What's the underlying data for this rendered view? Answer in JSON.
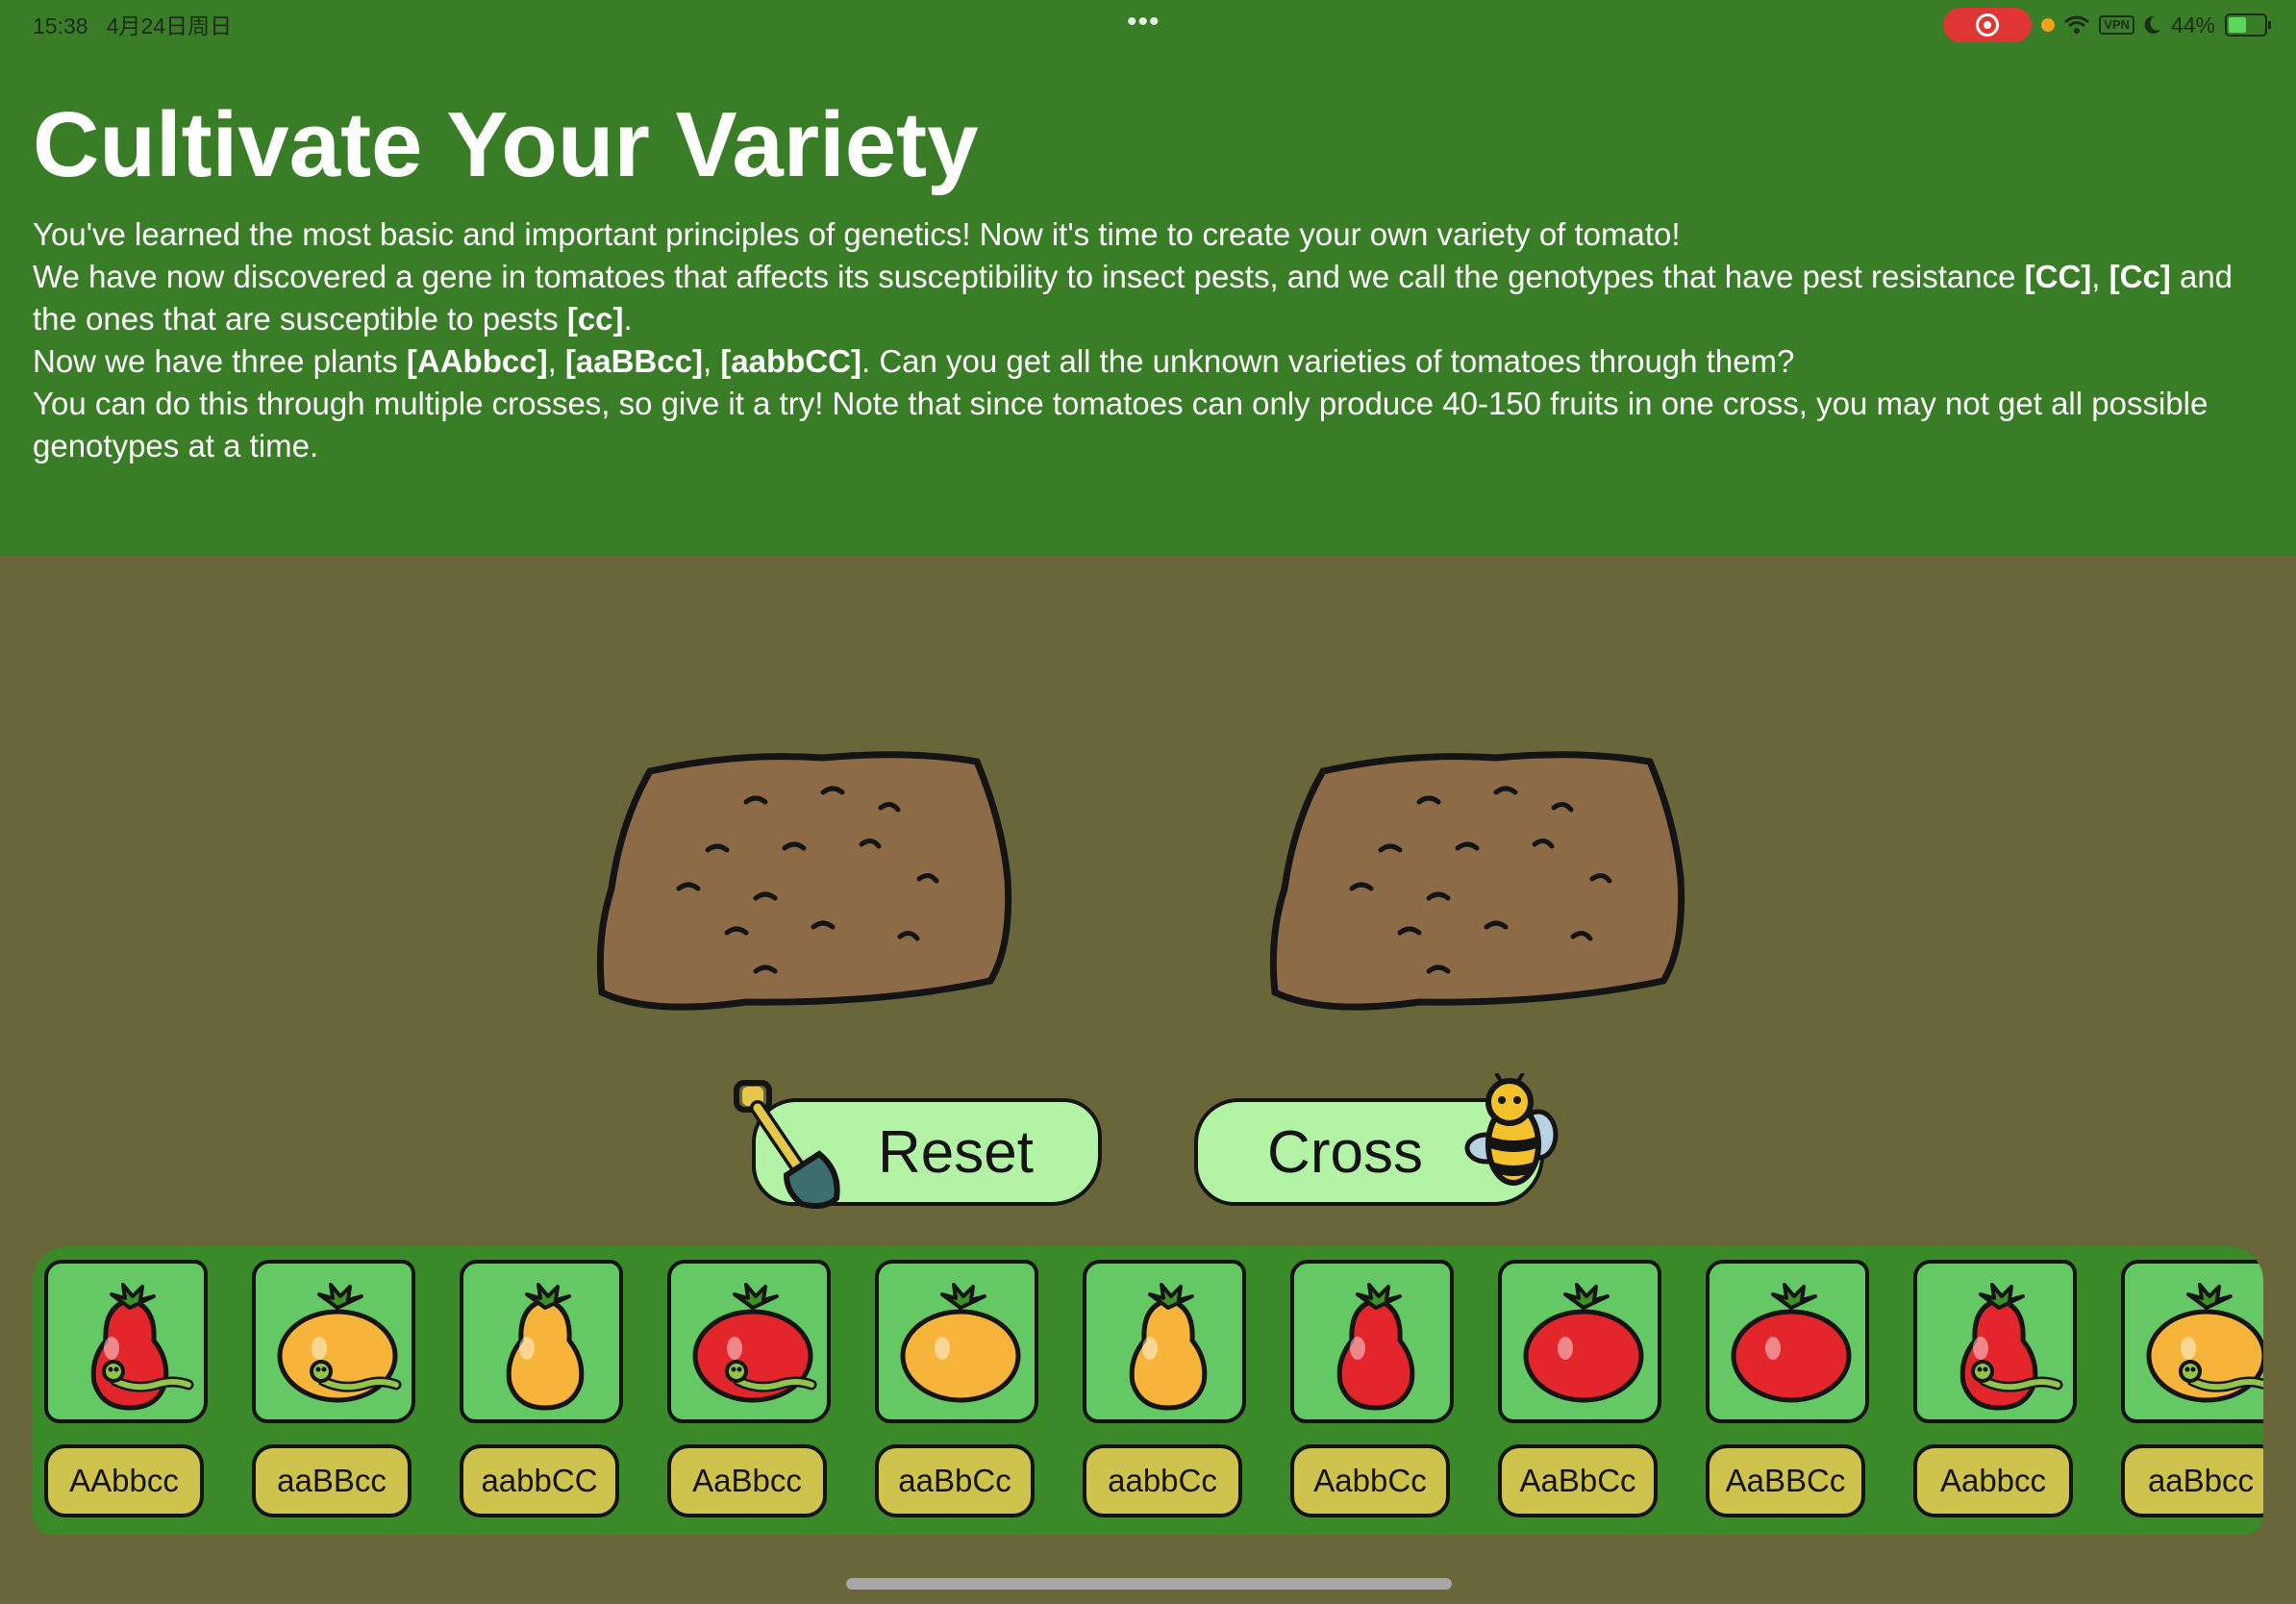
{
  "status_bar": {
    "time": "15:38",
    "date": "4月24日周日",
    "more_dots": "•••",
    "vpn": "VPN",
    "battery": "44%"
  },
  "header": {
    "title": "Cultivate Your Variety",
    "para1": "You've learned the most basic and important principles of genetics! Now it's time to create your own variety of tomato!",
    "para2": {
      "text_a": "We have now discovered a gene in tomatoes that affects its susceptibility to insect pests, and we call the genotypes that have pest resistance ",
      "b1": "[CC]",
      "text_b": ", ",
      "b2": "[Cc]",
      "text_c": " and the ones that are susceptible to pests ",
      "b3": "[cc]",
      "text_d": "."
    },
    "para3": {
      "text_a": "Now we have three plants ",
      "b1": "[AAbbcc]",
      "text_b": ", ",
      "b2": "[aaBBcc]",
      "text_c": ", ",
      "b3": "[aabbCC]",
      "text_d": ". Can you get all the unknown varieties of tomatoes through them?"
    },
    "para4": "You can do this through multiple crosses, so give it a try! Note that since tomatoes can only produce 40-150 fruits in one cross, you may not get all possible genotypes at a time."
  },
  "buttons": {
    "reset": "Reset",
    "cross": "Cross"
  },
  "varieties": [
    {
      "label": "AAbbcc",
      "color": "red",
      "shape": "pear",
      "worm": true
    },
    {
      "label": "aaBBcc",
      "color": "yellow",
      "shape": "round",
      "worm": true
    },
    {
      "label": "aabbCC",
      "color": "yellow",
      "shape": "pear",
      "worm": false
    },
    {
      "label": "AaBbcc",
      "color": "red",
      "shape": "round",
      "worm": true
    },
    {
      "label": "aaBbCc",
      "color": "yellow",
      "shape": "round",
      "worm": false
    },
    {
      "label": "aabbCc",
      "color": "yellow",
      "shape": "pear",
      "worm": false
    },
    {
      "label": "AabbCc",
      "color": "red",
      "shape": "pear",
      "worm": false
    },
    {
      "label": "AaBbCc",
      "color": "red",
      "shape": "round",
      "worm": false
    },
    {
      "label": "AaBBCc",
      "color": "red",
      "shape": "round",
      "worm": false
    },
    {
      "label": "Aabbcc",
      "color": "red",
      "shape": "pear",
      "worm": true
    },
    {
      "label": "aaBbcc",
      "color": "yellow",
      "shape": "round",
      "worm": true
    }
  ],
  "colors": {
    "header_bg": "#3a7d27",
    "ground_bg": "#69663a",
    "tray_bg": "#3b8a2a",
    "packet_bg": "#64c865",
    "label_bg": "#cec34c",
    "button_bg": "#b3f3a6",
    "tomato_red": "#e2262c",
    "tomato_yellow": "#f6b43b"
  }
}
